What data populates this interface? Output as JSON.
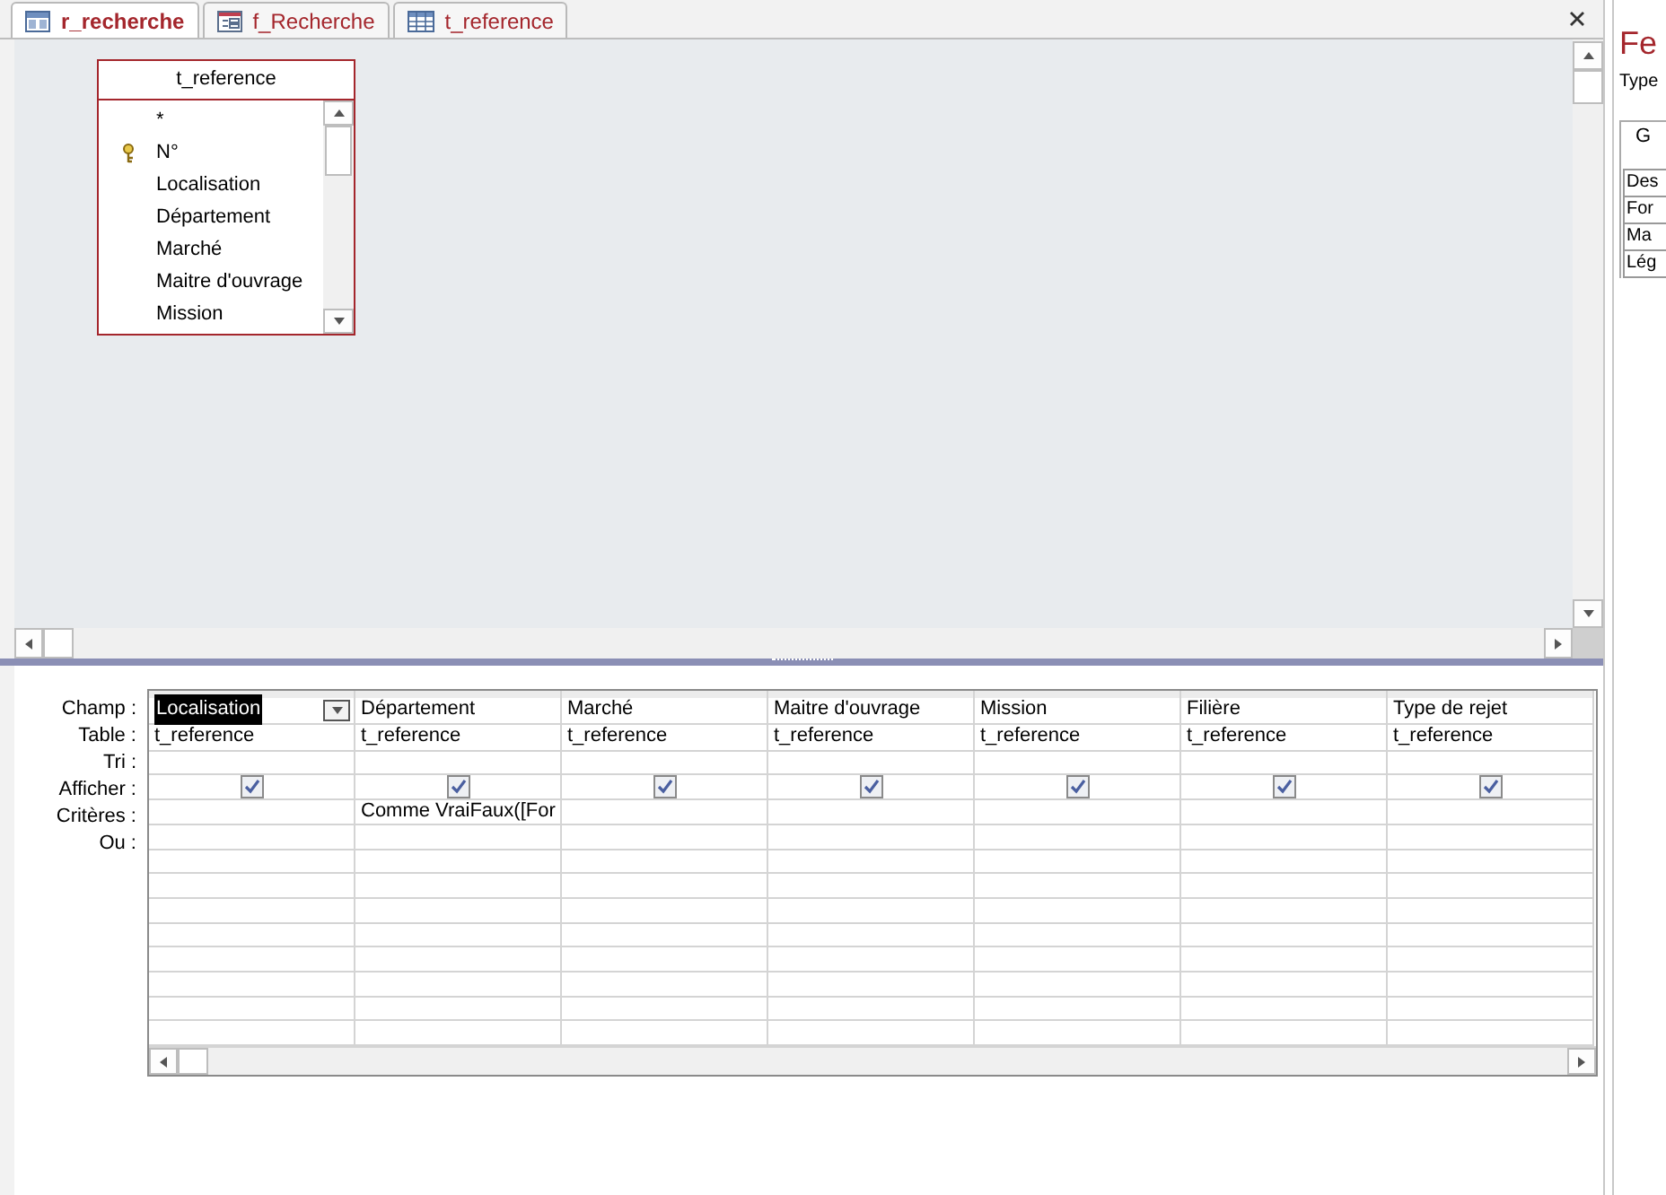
{
  "tabs": [
    {
      "label": "r_recherche",
      "kind": "query",
      "selected": true
    },
    {
      "label": "f_Recherche",
      "kind": "form",
      "selected": false
    },
    {
      "label": "t_reference",
      "kind": "table",
      "selected": false
    }
  ],
  "field_list": {
    "title": "t_reference",
    "fields": [
      {
        "name": "*",
        "key": false
      },
      {
        "name": "N°",
        "key": true
      },
      {
        "name": "Localisation",
        "key": false
      },
      {
        "name": "Département",
        "key": false
      },
      {
        "name": "Marché",
        "key": false
      },
      {
        "name": "Maitre d'ouvrage",
        "key": false
      },
      {
        "name": "Mission",
        "key": false
      }
    ]
  },
  "grid": {
    "row_labels": [
      "Champ :",
      "Table :",
      "Tri :",
      "Afficher :",
      "Critères :",
      "Ou :"
    ],
    "columns": [
      {
        "field": "Localisation",
        "table": "t_reference",
        "show": true,
        "selected": true
      },
      {
        "field": "Département",
        "table": "t_reference",
        "show": true,
        "criteria": "Comme VraiFaux([For",
        "selected": false
      },
      {
        "field": "Marché",
        "table": "t_reference",
        "show": true,
        "selected": false
      },
      {
        "field": "Maitre d'ouvrage",
        "table": "t_reference",
        "show": true,
        "selected": false
      },
      {
        "field": "Mission",
        "table": "t_reference",
        "show": true,
        "selected": false
      },
      {
        "field": "Filière",
        "table": "t_reference",
        "show": true,
        "selected": false
      },
      {
        "field": "Type de rejet",
        "table": "t_reference",
        "show": true,
        "selected": false
      }
    ]
  },
  "property_sheet": {
    "title": "Fe",
    "subtitle": "Type",
    "tab": "G",
    "rows": [
      "Des",
      "For",
      "Ma",
      "Lég"
    ]
  }
}
